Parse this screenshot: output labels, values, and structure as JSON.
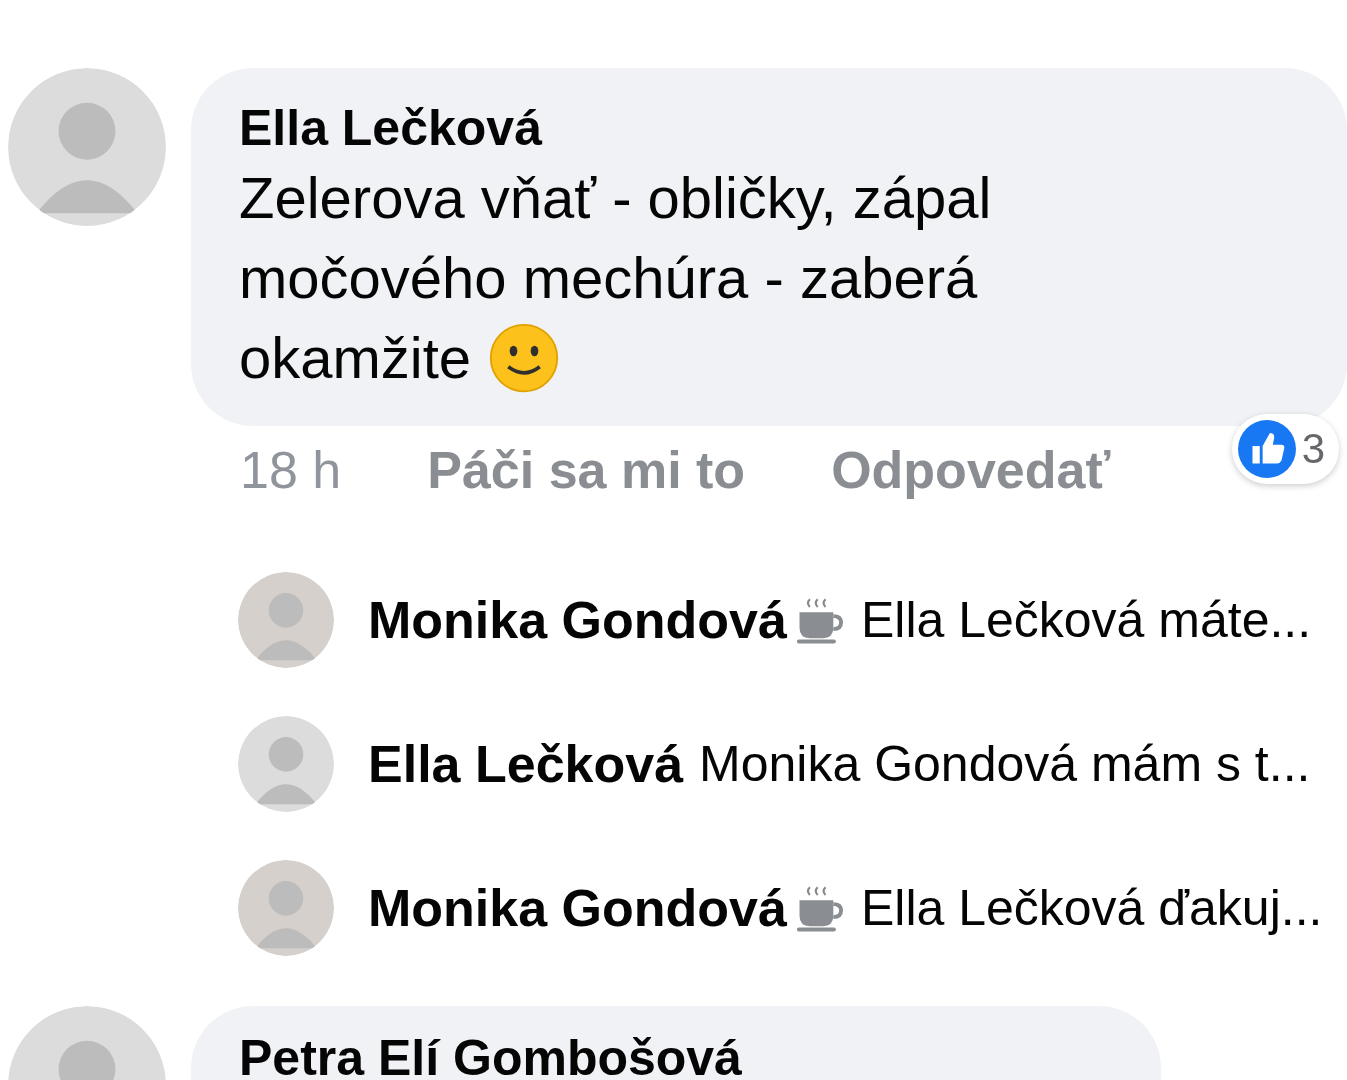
{
  "comment": {
    "author": "Ella Lečková",
    "text_lines": [
      "Zelerova vňať - obličky, zápal",
      "močového mechúra - zaberá",
      "okamžite"
    ],
    "time": "18 h",
    "actions": [
      "Páči sa mi to",
      "Odpovedať"
    ],
    "likes": "3"
  },
  "replies": [
    {
      "author": "Monika Gondová",
      "coffee": true,
      "text": "Ella Lečková máte..."
    },
    {
      "author": "Ella Lečková",
      "coffee": false,
      "text": "Monika Gondová mám s t..."
    },
    {
      "author": "Monika Gondová",
      "coffee": true,
      "text": "Ella Lečková ďakuj..."
    }
  ],
  "next_comment": {
    "author": "Petra Elí Gombošová"
  }
}
